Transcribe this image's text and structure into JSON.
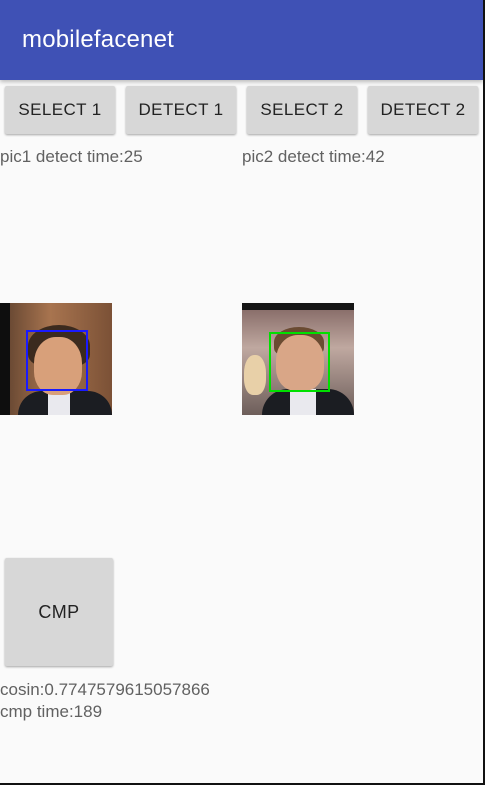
{
  "app": {
    "title": "mobilefacenet",
    "accent": "#3f51b5"
  },
  "buttons": {
    "select1": "SELECT 1",
    "detect1": "DETECT 1",
    "select2": "SELECT 2",
    "detect2": "DETECT 2",
    "cmp": "CMP"
  },
  "results": {
    "pic1_time": "pic1 detect time:25",
    "pic2_time": "pic2 detect time:42",
    "cosin": "cosin:0.7747579615057866",
    "cmp_time": "cmp time:189"
  },
  "detections": {
    "pic1_box_color": "#1a1aff",
    "pic2_box_color": "#00e000"
  }
}
